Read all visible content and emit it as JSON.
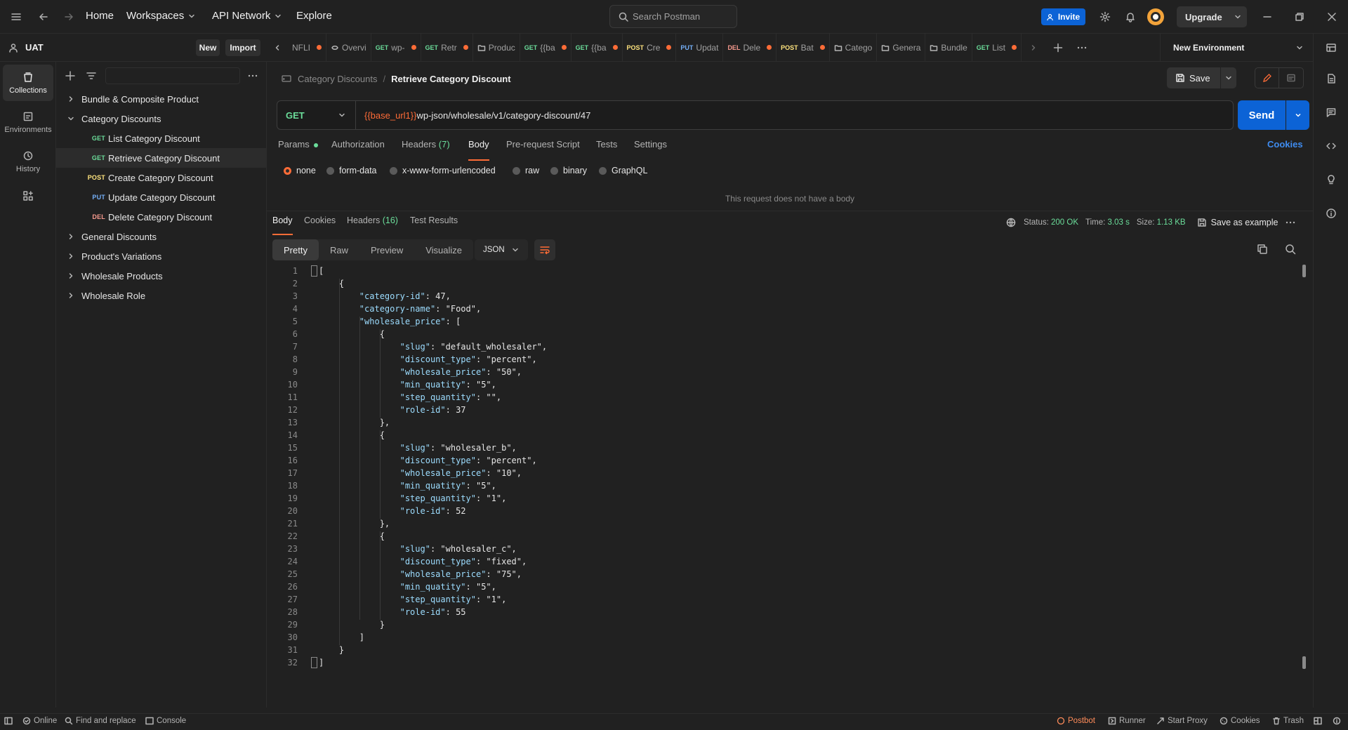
{
  "topbar": {
    "nav": [
      "Home",
      "Workspaces",
      "API Network",
      "Explore"
    ],
    "search_placeholder": "Search Postman",
    "invite_label": "Invite",
    "upgrade_label": "Upgrade"
  },
  "workspace": {
    "name": "UAT",
    "new_label": "New",
    "import_label": "Import"
  },
  "rail": [
    {
      "label": "Collections",
      "icon": "collections-icon"
    },
    {
      "label": "Environments",
      "icon": "environments-icon"
    },
    {
      "label": "History",
      "icon": "history-icon"
    }
  ],
  "tree": [
    {
      "label": "Bundle & Composite Product",
      "type": "folder",
      "expanded": false
    },
    {
      "label": "Category Discounts",
      "type": "folder",
      "expanded": true
    },
    {
      "label": "List Category Discount",
      "type": "request",
      "method": "GET"
    },
    {
      "label": "Retrieve Category Discount",
      "type": "request",
      "method": "GET",
      "active": true
    },
    {
      "label": "Create Category Discount",
      "type": "request",
      "method": "POST"
    },
    {
      "label": "Update Category Discount",
      "type": "request",
      "method": "PUT"
    },
    {
      "label": "Delete Category Discount",
      "type": "request",
      "method": "DEL"
    },
    {
      "label": "General Discounts",
      "type": "folder",
      "expanded": false
    },
    {
      "label": "Product's Variations",
      "type": "folder",
      "expanded": false
    },
    {
      "label": "Wholesale Products",
      "type": "folder",
      "expanded": false
    },
    {
      "label": "Wholesale Role",
      "type": "folder",
      "expanded": false
    }
  ],
  "tabs": [
    {
      "method": "",
      "label": "NFLI",
      "dot": true
    },
    {
      "method": "",
      "label": "Overvi",
      "icon": "overview-icon",
      "dot": false
    },
    {
      "method": "GET",
      "label": "wp-",
      "dot": true
    },
    {
      "method": "GET",
      "label": "Retr",
      "dot": true
    },
    {
      "method": "",
      "label": "Produc",
      "icon": "folder-icon",
      "dot": false
    },
    {
      "method": "GET",
      "label": "{{ba",
      "dot": true
    },
    {
      "method": "GET",
      "label": "{{ba",
      "dot": true
    },
    {
      "method": "POST",
      "label": "Cre",
      "dot": true
    },
    {
      "method": "PUT",
      "label": "Updat",
      "dot": false
    },
    {
      "method": "DEL",
      "label": "Dele",
      "dot": true
    },
    {
      "method": "POST",
      "label": "Bat",
      "dot": true
    },
    {
      "method": "",
      "label": "Catego",
      "icon": "folder-icon",
      "dot": false
    },
    {
      "method": "",
      "label": "Genera",
      "icon": "folder-icon",
      "dot": false
    },
    {
      "method": "",
      "label": "Bundle",
      "icon": "folder-icon",
      "dot": false
    },
    {
      "method": "GET",
      "label": "List",
      "dot": true
    }
  ],
  "environment": "New Environment",
  "breadcrumb": {
    "parent": "Category Discounts",
    "current": "Retrieve Category Discount"
  },
  "save_label": "Save",
  "request": {
    "method": "GET",
    "url_var": "{{base_url1}}",
    "url_path": "wp-json/wholesale/v1/category-discount/47",
    "send_label": "Send"
  },
  "request_tabs": {
    "params": "Params",
    "authorization": "Authorization",
    "headers": "Headers",
    "headers_count": "(7)",
    "body": "Body",
    "prerequest": "Pre-request Script",
    "tests": "Tests",
    "settings": "Settings",
    "cookies": "Cookies"
  },
  "body_types": [
    "none",
    "form-data",
    "x-www-form-urlencoded",
    "raw",
    "binary",
    "GraphQL"
  ],
  "no_body_message": "This request does not have a body",
  "response": {
    "tabs": {
      "body": "Body",
      "cookies": "Cookies",
      "headers": "Headers",
      "headers_count": "(16)",
      "test_results": "Test Results"
    },
    "status_label": "Status:",
    "status_value": "200 OK",
    "time_label": "Time:",
    "time_value": "3.03 s",
    "size_label": "Size:",
    "size_value": "1.13 KB",
    "save_example": "Save as example",
    "views": [
      "Pretty",
      "Raw",
      "Preview",
      "Visualize"
    ],
    "format": "JSON"
  },
  "code_lines": [
    "[",
    "    {",
    "        \"category-id\": 47,",
    "        \"category-name\": \"Food\",",
    "        \"wholesale_price\": [",
    "            {",
    "                \"slug\": \"default_wholesaler\",",
    "                \"discount_type\": \"percent\",",
    "                \"wholesale_price\": \"50\",",
    "                \"min_quatity\": \"5\",",
    "                \"step_quantity\": \"\",",
    "                \"role-id\": 37",
    "            },",
    "            {",
    "                \"slug\": \"wholesaler_b\",",
    "                \"discount_type\": \"percent\",",
    "                \"wholesale_price\": \"10\",",
    "                \"min_quatity\": \"5\",",
    "                \"step_quantity\": \"1\",",
    "                \"role-id\": 52",
    "            },",
    "            {",
    "                \"slug\": \"wholesaler_c\",",
    "                \"discount_type\": \"fixed\",",
    "                \"wholesale_price\": \"75\",",
    "                \"min_quatity\": \"5\",",
    "                \"step_quantity\": \"1\",",
    "                \"role-id\": 55",
    "            }",
    "        ]",
    "    }",
    "]"
  ],
  "statusbar": {
    "online": "Online",
    "find_replace": "Find and replace",
    "console": "Console",
    "postbot": "Postbot",
    "runner": "Runner",
    "start_proxy": "Start Proxy",
    "cookies": "Cookies",
    "trash": "Trash"
  },
  "colors": {
    "accent": "#ff6c37",
    "primary": "#0c63d6",
    "get": "#6bdd9a",
    "post": "#ffe47e",
    "put": "#74aef6",
    "del": "#f79a8e"
  }
}
